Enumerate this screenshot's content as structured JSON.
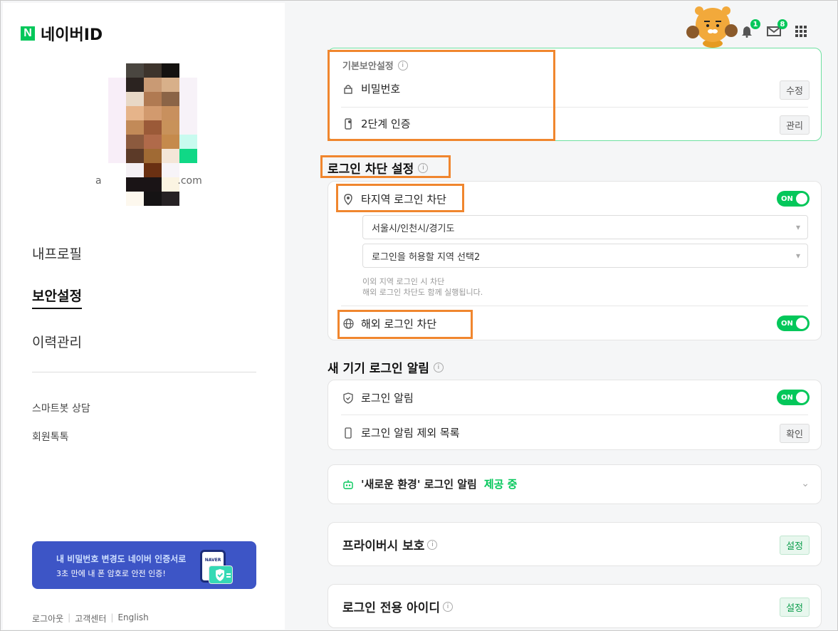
{
  "sidebar": {
    "logo_n": "N",
    "logo_text": "네이버ID",
    "email": "a                        .com",
    "menu": [
      "내프로필",
      "보안설정",
      "이력관리"
    ],
    "sub1": "스마트봇 상담",
    "sub2": "회원톡톡",
    "banner_line1": "내 비밀번호 변경도 네이버 인증서로",
    "banner_line2": "3초 만에 내 폰 암호로 안전 인증!",
    "banner_phone_label": "NAVER",
    "footer": [
      "로그아웃",
      "고객센터",
      "English"
    ]
  },
  "top": {
    "bell_badge": "1",
    "mail_badge": "8"
  },
  "basic_security": {
    "title": "기본보안설정",
    "password_label": "비밀번호",
    "password_btn": "수정",
    "twostep_label": "2단계 인증",
    "twostep_btn": "관리"
  },
  "login_block": {
    "title": "로그인 차단 설정",
    "region_label": "타지역 로그인 차단",
    "region_toggle": "ON",
    "select1": "서울시/인천시/경기도",
    "select2": "로그인을 허용할 지역 선택2",
    "hint1": "이외 지역 로그인 시 차단",
    "hint2": "해외 로그인 차단도 함께 실행됩니다.",
    "overseas_label": "해외 로그인 차단",
    "overseas_toggle": "ON"
  },
  "new_device": {
    "title": "새 기기 로그인 알림",
    "alert_label": "로그인 알림",
    "alert_toggle": "ON",
    "exclude_label": "로그인 알림 제외 목록",
    "exclude_btn": "확인"
  },
  "new_env": {
    "label": "'새로운 환경' 로그인 알림",
    "status": "제공 중"
  },
  "privacy": {
    "label": "프라이버시 보호",
    "btn": "설정"
  },
  "login_only": {
    "label": "로그인 전용 아이디",
    "btn": "설정"
  },
  "colors": {
    "accent": "#03c75a",
    "highlight": "#f0862e"
  }
}
